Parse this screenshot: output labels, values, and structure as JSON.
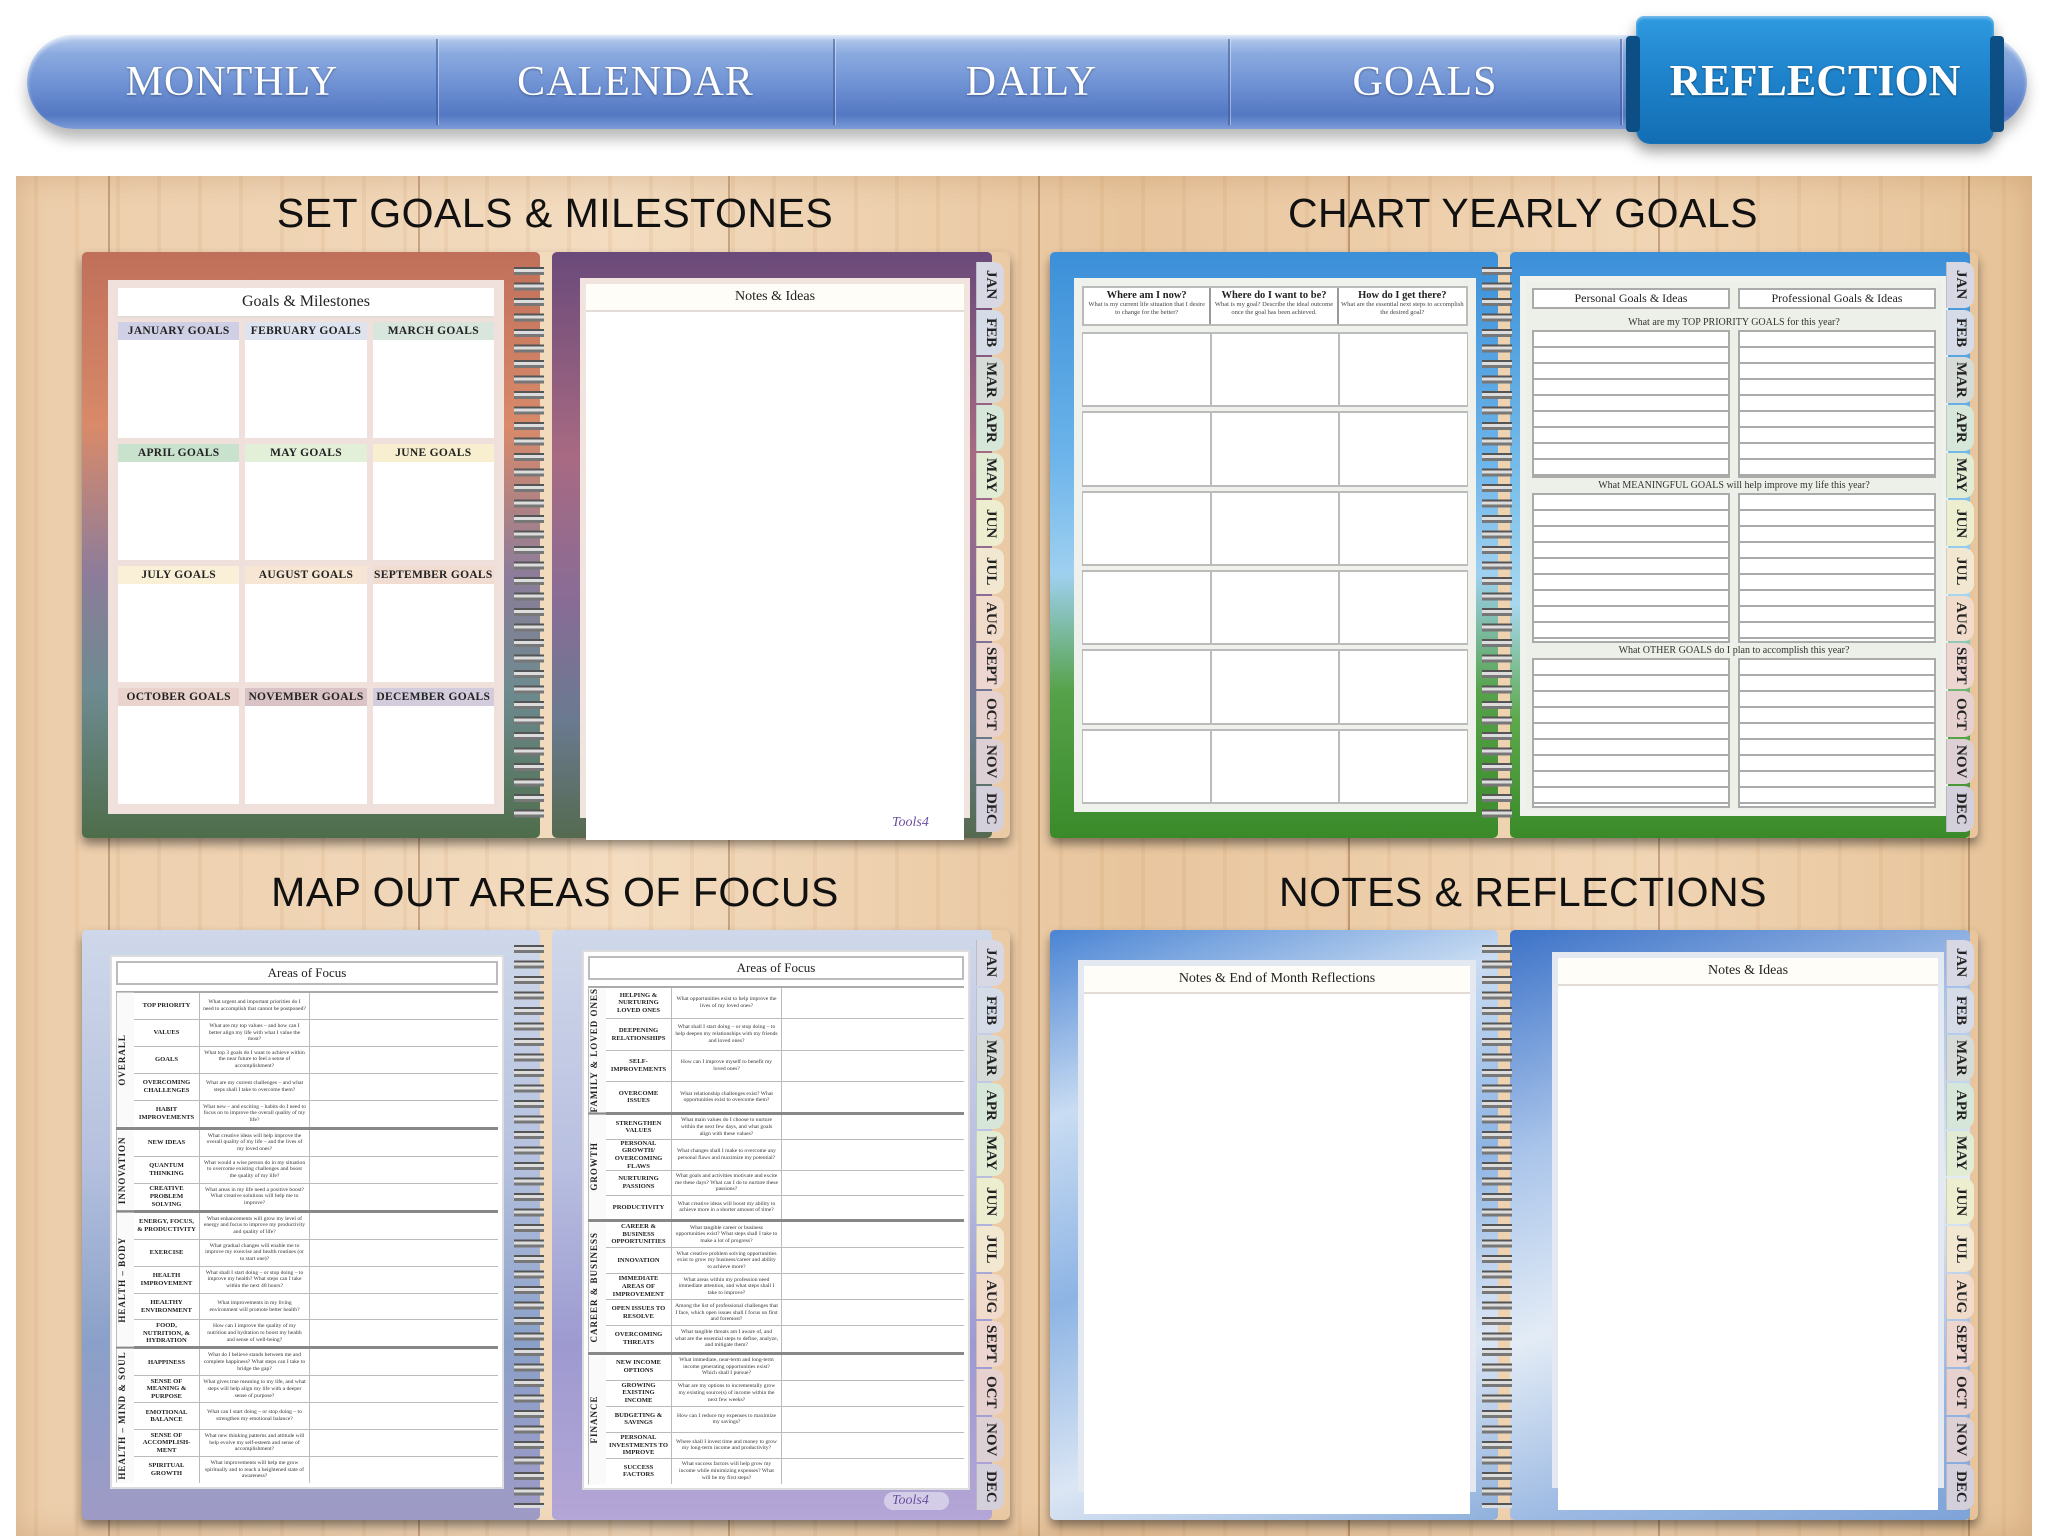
{
  "nav": {
    "tabs": [
      "MONTHLY",
      "CALENDAR",
      "DAILY",
      "GOALS"
    ],
    "active_tab": "REFLECTION",
    "colors": {
      "bar": "#6d90d3",
      "active": "#1f84cc"
    }
  },
  "sections": {
    "set_goals": "SET GOALS & MILESTONES",
    "chart_goals": "CHART YEARLY GOALS",
    "areas_focus": "MAP OUT AREAS OF FOCUS",
    "notes": "NOTES & REFLECTIONS"
  },
  "months_tabs": [
    "JAN",
    "FEB",
    "MAR",
    "APR",
    "MAY",
    "JUN",
    "JUL",
    "AUG",
    "SEPT",
    "OCT",
    "NOV",
    "DEC"
  ],
  "month_tab_colors": [
    "#d8d8e4",
    "#d6dbe8",
    "#d7dbd8",
    "#d6e6d8",
    "#e2ecd5",
    "#eceecf",
    "#f2e8d2",
    "#f1dccb",
    "#ecd6cf",
    "#e6d1cf",
    "#ddd0d4",
    "#d3cfdb"
  ],
  "goals_page": {
    "title": "Goals & Milestones",
    "months": [
      {
        "label": "JANUARY GOALS",
        "color": "#cfcfe6"
      },
      {
        "label": "FEBRUARY GOALS",
        "color": "#dde3ef"
      },
      {
        "label": "MARCH GOALS",
        "color": "#d9e6de"
      },
      {
        "label": "APRIL GOALS",
        "color": "#c9e2cd"
      },
      {
        "label": "MAY GOALS",
        "color": "#e2efd9"
      },
      {
        "label": "JUNE GOALS",
        "color": "#f7efcf"
      },
      {
        "label": "JULY GOALS",
        "color": "#faf0d8"
      },
      {
        "label": "AUGUST GOALS",
        "color": "#f6e6d3"
      },
      {
        "label": "SEPTEMBER GOALS",
        "color": "#f0dcd0"
      },
      {
        "label": "OCTOBER GOALS",
        "color": "#ead3cd"
      },
      {
        "label": "NOVEMBER GOALS",
        "color": "#d9c3c6"
      },
      {
        "label": "DECEMBER GOALS",
        "color": "#d2ccdc"
      }
    ]
  },
  "notes_ideas_title": "Notes & Ideas",
  "logo_text": "Tools4",
  "chart_yearly": {
    "columns": [
      {
        "title": "Where am I now?",
        "sub": "What is my current life situation that I desire to change for the better?"
      },
      {
        "title": "Where do I want to be?",
        "sub": "What is my goal? Describe the ideal outcome once the goal has been achieved."
      },
      {
        "title": "How do I get there?",
        "sub": "What are the essential next steps to accomplish the desired goal?"
      }
    ]
  },
  "personal_professional": {
    "headers": [
      "Personal Goals & Ideas",
      "Professional Goals & Ideas"
    ],
    "questions": [
      "What are my TOP PRIORITY GOALS for this year?",
      "What MEANINGFUL GOALS will help improve my life this year?",
      "What OTHER GOALS do I plan to accomplish this year?"
    ]
  },
  "areas_left": {
    "title": "Areas of Focus",
    "groups": [
      {
        "label": "OVERALL",
        "rows": [
          {
            "name": "TOP PRIORITY",
            "q": "What urgent and important priorities do I need to accomplish that cannot be postponed?"
          },
          {
            "name": "VALUES",
            "q": "What are my top values – and how can I better align my life with what I value the most?"
          },
          {
            "name": "GOALS",
            "q": "What top 3 goals do I want to achieve within the near future to feel a sense of accomplishment?"
          },
          {
            "name": "OVERCOMING CHALLENGES",
            "q": "What are my current challenges – and what steps shall I take to overcome them?"
          },
          {
            "name": "HABIT IMPROVEMENTS",
            "q": "What new – and exciting – habits do I need to focus on to improve the overall quality of my life?"
          }
        ]
      },
      {
        "label": "INNOVATION",
        "rows": [
          {
            "name": "NEW IDEAS",
            "q": "What creative ideas will help improve the overall quality of my life – and the lives of my loved ones?"
          },
          {
            "name": "QUANTUM THINKING",
            "q": "What would a wise person do in my situation to overcome existing challenges and boost the quality of my life?"
          },
          {
            "name": "CREATIVE PROBLEM SOLVING",
            "q": "What areas in my life need a positive boost? What creative solutions will help me to improve?"
          }
        ]
      },
      {
        "label": "HEALTH – BODY",
        "rows": [
          {
            "name": "ENERGY, FOCUS, & PRODUCTIVITY",
            "q": "What enhancements will grow my level of energy and focus to improve my productivity and quality of life?"
          },
          {
            "name": "EXERCISE",
            "q": "What gradual changes will enable me to improve my exercise and health routines (or to start one)?"
          },
          {
            "name": "HEALTH IMPROVEMENT",
            "q": "What shall I start doing – or stop doing – to improve my health? What steps can I take within the next 48 hours?"
          },
          {
            "name": "HEALTHY ENVIRONMENT",
            "q": "What improvements in my living environment will promote better health?"
          },
          {
            "name": "FOOD, NUTRITION, & HYDRATION",
            "q": "How can I improve the quality of my nutrition and hydration to boost my health and sense of well-being?"
          }
        ]
      },
      {
        "label": "HEALTH – MIND & SOUL",
        "rows": [
          {
            "name": "HAPPINESS",
            "q": "What do I believe stands between me and complete happiness? What steps can I take to bridge the gap?"
          },
          {
            "name": "SENSE OF MEANING & PURPOSE",
            "q": "What gives true meaning to my life, and what steps will help align my life with a deeper sense of purpose?"
          },
          {
            "name": "EMOTIONAL BALANCE",
            "q": "What can I start doing – or stop doing – to strengthen my emotional balance?"
          },
          {
            "name": "SENSE OF ACCOMPLISH-MENT",
            "q": "What new thinking patterns and attitude will help evolve my self-esteem and sense of accomplishment?"
          },
          {
            "name": "SPIRITUAL GROWTH",
            "q": "What improvements will help me grow spiritually and to reach a heightened state of awareness?"
          }
        ]
      }
    ]
  },
  "areas_right": {
    "title": "Areas of Focus",
    "groups": [
      {
        "label": "FAMILY & LOVED ONES",
        "rows": [
          {
            "name": "HELPING & NURTURING LOVED ONES",
            "q": "What opportunities exist to help improve the lives of my loved ones?"
          },
          {
            "name": "DEEPENING RELATIONSHIPS",
            "q": "What shall I start doing – or stop doing – to help deepen my relationships with my friends and loved ones?"
          },
          {
            "name": "SELF-IMPROVEMENTS",
            "q": "How can I improve myself to benefit my loved ones?"
          },
          {
            "name": "OVERCOME ISSUES",
            "q": "What relationship challenges exist? What opportunities exist to overcome them?"
          }
        ]
      },
      {
        "label": "GROWTH",
        "rows": [
          {
            "name": "STRENGTHEN VALUES",
            "q": "What main values do I choose to nurture within the next few days, and what goals align with these values?"
          },
          {
            "name": "PERSONAL GROWTH/ OVERCOMING FLAWS",
            "q": "What changes shall I make to overcome any personal flaws and maximize my potential?"
          },
          {
            "name": "NURTURING PASSIONS",
            "q": "What goals and activities motivate and excite me these days? What can I do to nurture these passions?"
          },
          {
            "name": "PRODUCTIVITY",
            "q": "What creative ideas will boost my ability to achieve more in a shorter amount of time?"
          }
        ]
      },
      {
        "label": "CAREER & BUSINESS",
        "rows": [
          {
            "name": "CAREER & BUSINESS OPPORTUNITIES",
            "q": "What tangible career or business opportunities exist? What steps shall I take to make a lot of progress?"
          },
          {
            "name": "INNOVATION",
            "q": "What creative problem solving opportunities exist to grow my business/career and ability to achieve more?"
          },
          {
            "name": "IMMEDIATE AREAS OF IMPROVEMENT",
            "q": "What areas within my profession need immediate attention, and what steps shall I take to improve?"
          },
          {
            "name": "OPEN ISSUES TO RESOLVE",
            "q": "Among the list of professional challenges that I face, which open issues shall I focus on first and foremost?"
          },
          {
            "name": "OVERCOMING THREATS",
            "q": "What tangible threats am I aware of, and what are the essential steps to define, analyze, and mitigate them?"
          }
        ]
      },
      {
        "label": "FINANCE",
        "rows": [
          {
            "name": "NEW INCOME OPTIONS",
            "q": "What immediate, near-term and long-term income generating opportunities exist? Which shall I pursue?"
          },
          {
            "name": "GROWING EXISTING INCOME",
            "q": "What are my options to incrementally grow my existing source(s) of income within the next few weeks?"
          },
          {
            "name": "BUDGETING & SAVINGS",
            "q": "How can I reduce my expenses to maximize my savings?"
          },
          {
            "name": "PERSONAL INVESTMENTS TO IMPROVE",
            "q": "Where shall I invest time and money to grow my long-term income and productivity?"
          },
          {
            "name": "SUCCESS FACTORS",
            "q": "What success factors will help grow my income while minimizing expenses? What will be my first steps?"
          }
        ]
      }
    ]
  },
  "notes_reflection_title": "Notes & End of Month Reflections"
}
